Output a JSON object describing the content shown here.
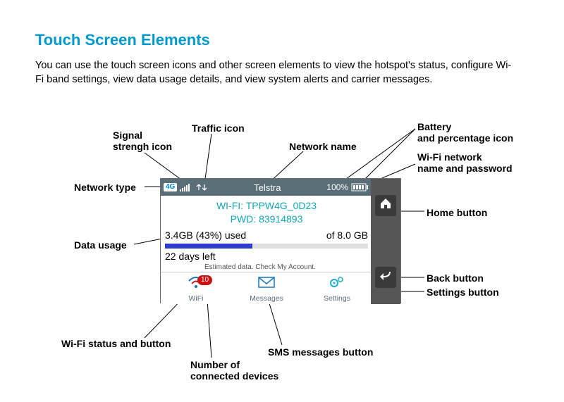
{
  "page": {
    "title": "Touch Screen Elements",
    "intro": "You can use the touch screen icons and other screen elements to view the hotspot's status, configure Wi-Fi band settings, view data usage details, and view system alerts and carrier messages."
  },
  "labels": {
    "signal": "Signal\nstrengh icon",
    "traffic": "Traffic icon",
    "network_name": "Network name",
    "battery": "Battery\nand percentage icon",
    "wifi_pass": "Wi-Fi network\nname and password",
    "home": "Home button",
    "network_type": "Network type",
    "data_usage": "Data usage",
    "back": "Back button",
    "settings": "Settings button",
    "wifi_status": "Wi-Fi status and button",
    "sms": "SMS messages button",
    "devices": "Number of\nconnected devices"
  },
  "device": {
    "network_type": "4G",
    "carrier": "Telstra",
    "battery_pct": "100%",
    "wifi_prefix": "WI-FI:",
    "wifi_name": "TPPW4G_0D23",
    "pwd_prefix": "PWD:",
    "pwd_value": "83914893",
    "data_used": "3.4GB (43%) used",
    "data_total": "of 8.0 GB",
    "progress_pct": "43",
    "days_left": "22 days left",
    "estimated": "Estimated data. Check My Account.",
    "wifi_label": "WiFi",
    "wifi_badge": "10",
    "messages_label": "Messages",
    "settings_label": "Settings"
  }
}
